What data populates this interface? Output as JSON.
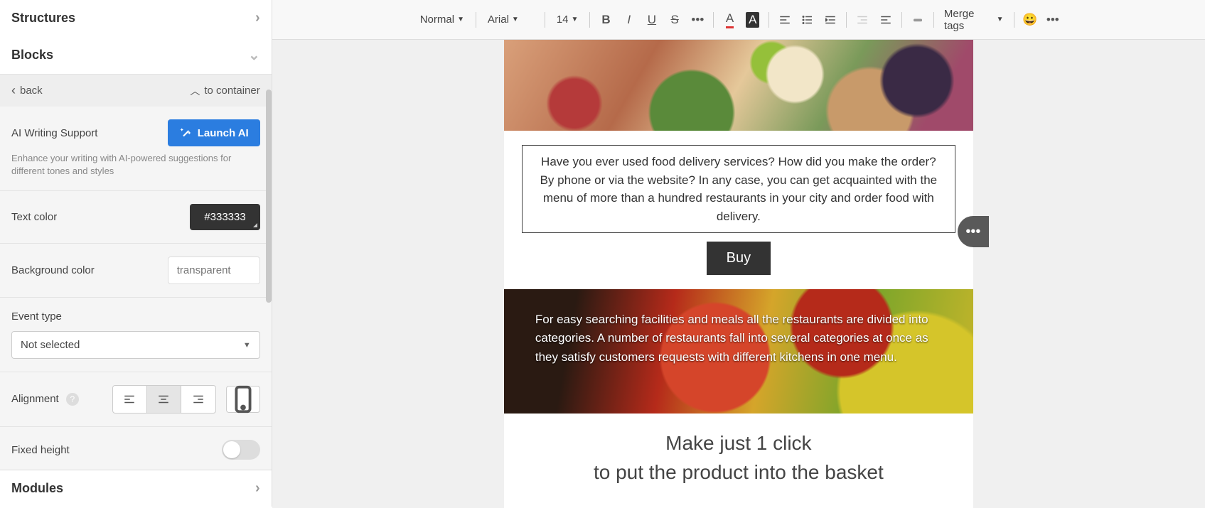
{
  "sidebar": {
    "structures_label": "Structures",
    "blocks_label": "Blocks",
    "modules_label": "Modules",
    "breadcrumb_back": "back",
    "breadcrumb_to": "to container",
    "ai": {
      "title": "AI Writing Support",
      "button": "Launch AI",
      "desc": "Enhance your writing with AI-powered suggestions for different tones and styles"
    },
    "text_color": {
      "label": "Text color",
      "value": "#333333"
    },
    "bg_color": {
      "label": "Background color",
      "placeholder": "transparent"
    },
    "event_type": {
      "label": "Event type",
      "value": "Not selected"
    },
    "alignment": {
      "label": "Alignment"
    },
    "fixed_height": {
      "label": "Fixed height"
    }
  },
  "toolbar": {
    "para": "Normal",
    "font": "Arial",
    "size": "14",
    "merge_tags": "Merge tags"
  },
  "email": {
    "paragraph1": "Have you ever used food delivery services? How did you make the order? By phone or via the website? In any case, you can get acquainted with the menu of more than a hundred restaurants in your city and order food with delivery.",
    "buy": "Buy",
    "paragraph2": "For easy searching facilities and meals all the restaurants are divided into categories. A number of restaurants fall into several categories at once as they satisfy customers requests with different kitchens in one menu.",
    "headline_l1": "Make just 1 click",
    "headline_l2": "to put the product into the basket"
  }
}
